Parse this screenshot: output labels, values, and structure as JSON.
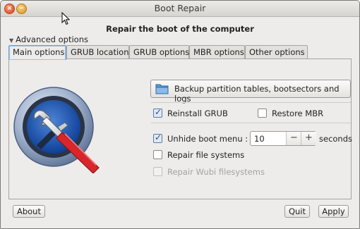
{
  "window": {
    "title": "Boot Repair",
    "close_glyph": "×",
    "min_glyph": "−"
  },
  "heading": "Repair the boot of the computer",
  "expander": {
    "label": "Advanced options",
    "arrow": "▼"
  },
  "tabs": [
    {
      "label": "Main options",
      "active": true
    },
    {
      "label": "GRUB location",
      "active": false
    },
    {
      "label": "GRUB options",
      "active": false
    },
    {
      "label": "MBR options",
      "active": false
    },
    {
      "label": "Other options",
      "active": false
    }
  ],
  "main": {
    "backup_button": "Backup partition tables, bootsectors and logs",
    "reinstall_grub": {
      "label": "Reinstall GRUB",
      "checked": true
    },
    "restore_mbr": {
      "label": "Restore MBR",
      "checked": false
    },
    "unhide_boot_menu": {
      "label": "Unhide boot menu :",
      "checked": true,
      "value": "10",
      "unit": "seconds",
      "minus": "−",
      "plus": "+"
    },
    "repair_fs": {
      "label": "Repair file systems",
      "checked": false
    },
    "repair_wubi": {
      "label": "Repair Wubi filesystems",
      "checked": false,
      "disabled": true
    }
  },
  "footer": {
    "about": "About",
    "quit": "Quit",
    "apply": "Apply"
  },
  "check_glyph": "✓"
}
